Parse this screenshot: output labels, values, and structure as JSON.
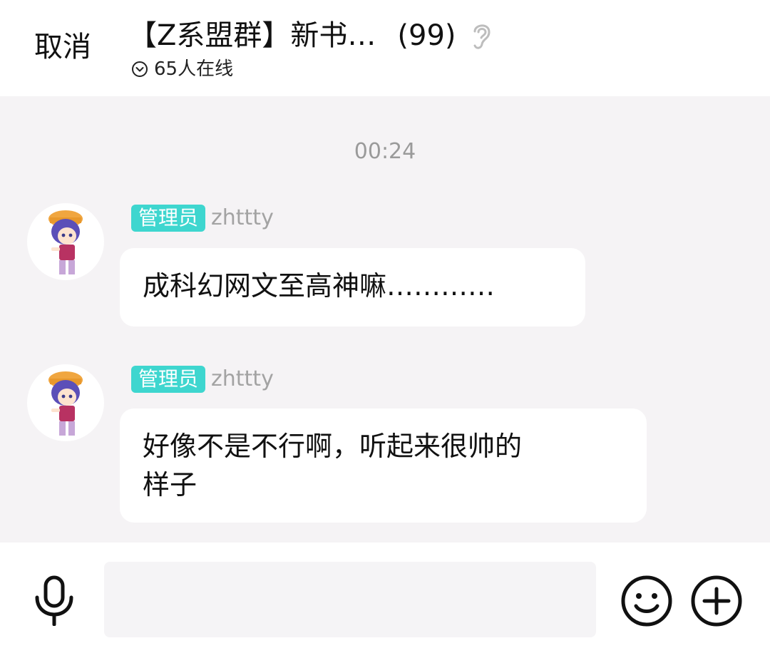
{
  "header": {
    "cancel_label": "取消",
    "title": "【Z系盟群】新书…",
    "count": "(99)",
    "online_text": "65人在线"
  },
  "chat": {
    "timestamp": "00:24",
    "messages": [
      {
        "badge": "管理员",
        "sender": "zhttty",
        "text": "成科幻网文至高神嘛…………"
      },
      {
        "badge": "管理员",
        "sender": "zhttty",
        "text_lines": [
          "好像不是不行啊，听起来很帅的",
          "样子"
        ]
      }
    ]
  },
  "input": {
    "value": "",
    "placeholder": ""
  },
  "icons": {
    "ear": "ear-icon",
    "online": "chevron-down-circle-icon",
    "mic": "microphone-icon",
    "emoji": "smiley-icon",
    "plus": "plus-circle-icon",
    "avatar": "anime-avatar"
  },
  "colors": {
    "badge": "#3ed6cf",
    "chat_background": "#f5f3f5",
    "timestamp": "#9a9a9a",
    "sender": "#a3a3a3"
  }
}
